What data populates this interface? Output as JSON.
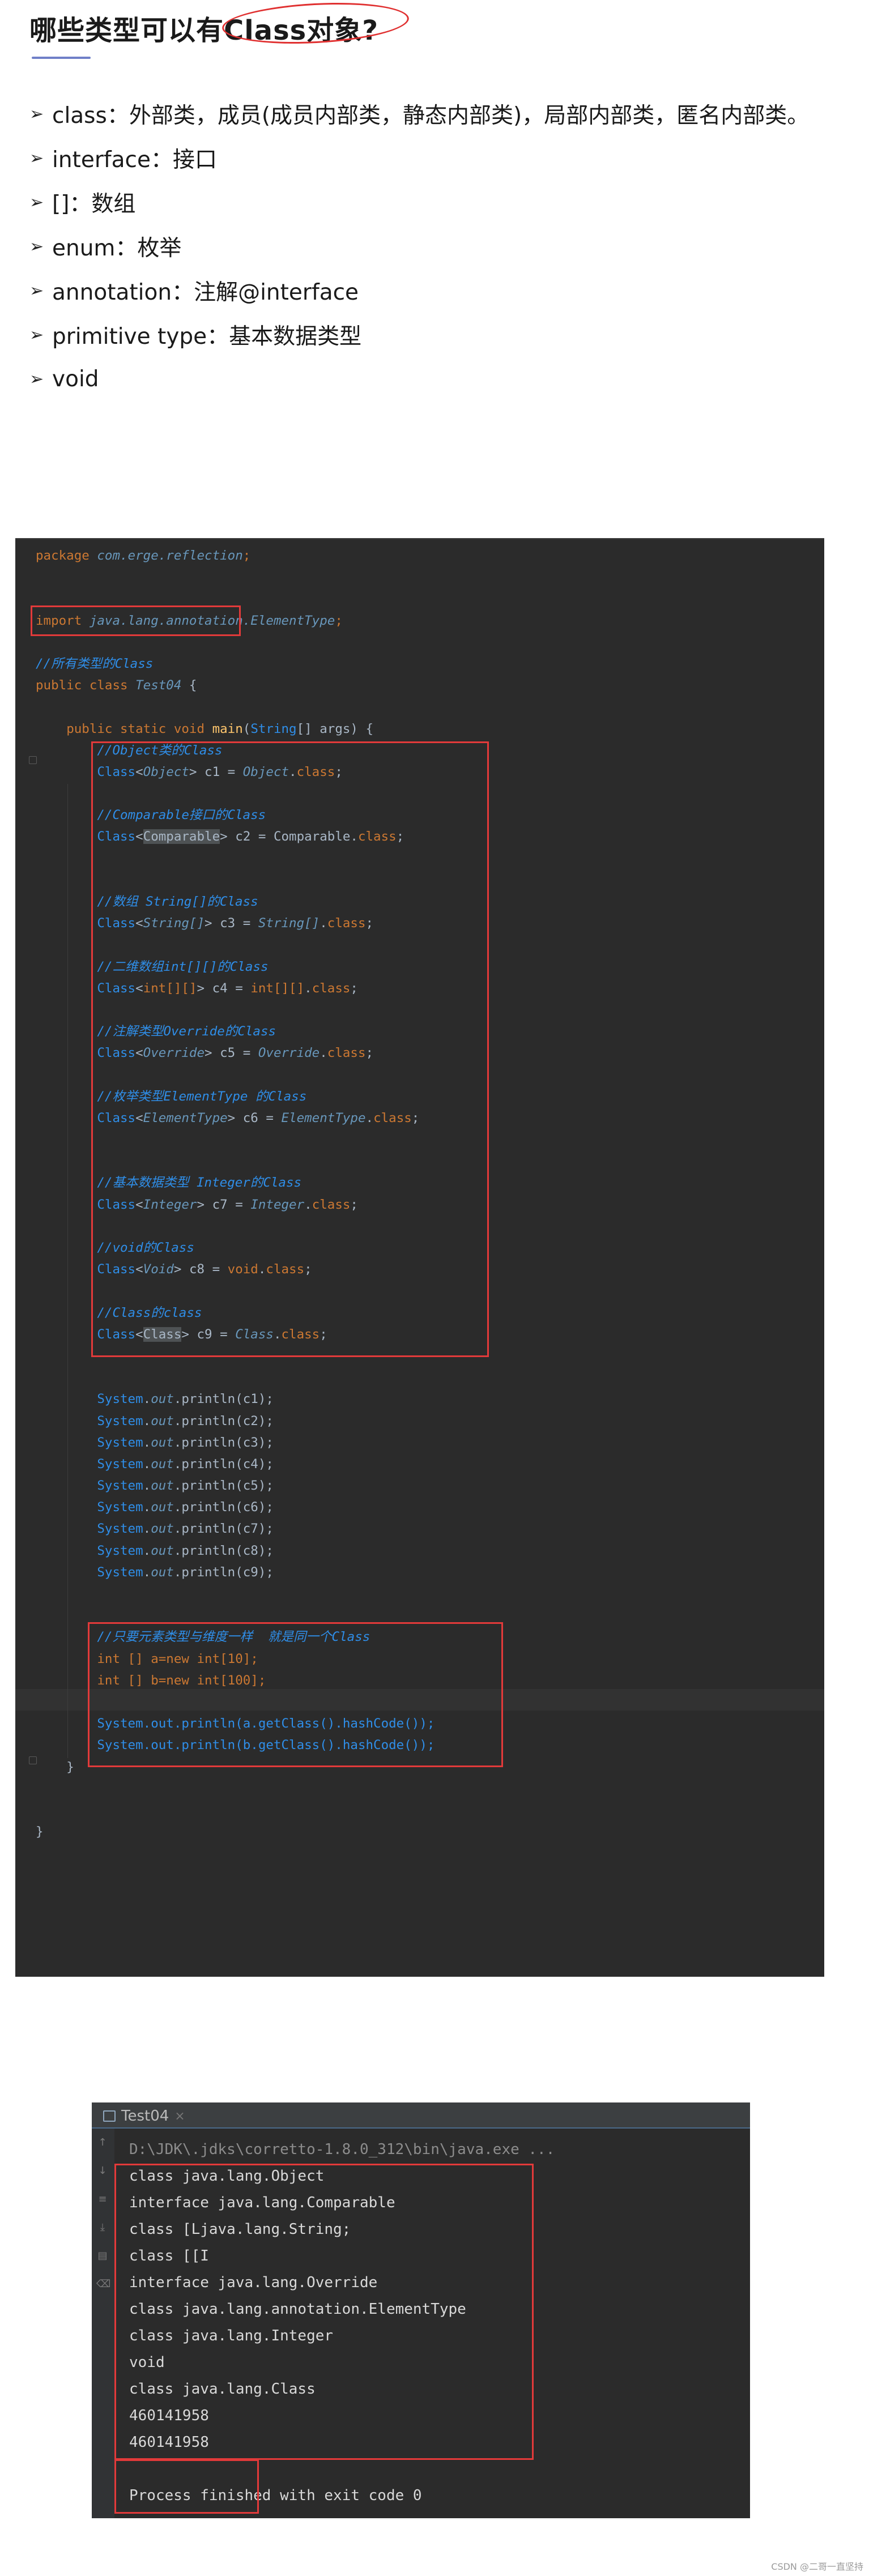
{
  "heading": {
    "title": "哪些类型可以有Class对象?"
  },
  "bullets": [
    "class：外部类，成员(成员内部类，静态内部类)，局部内部类，匿名内部类。",
    "interface：接口",
    "[]：数组",
    "enum：枚举",
    "annotation：注解@interface",
    "primitive type：基本数据类型",
    "void"
  ],
  "editor": {
    "package_kw": "package",
    "package_name": "com.erge.reflection",
    "import_kw": "import",
    "import_name": "java.lang.annotation.ElementType",
    "comment_all": "//所有类型的Class",
    "class_decl_kw": "public class",
    "class_name": "Test04",
    "main_sig_kw": "public static void",
    "main_name": "main",
    "main_param_type": "String",
    "main_param_rest": "[] args) {",
    "blocks": [
      {
        "comment": "//Object类的Class",
        "type": "Object",
        "var": "c1",
        "rhs_type": "Object"
      },
      {
        "comment": "//Comparable接口的Class",
        "type": "Comparable",
        "var": "c2",
        "rhs_type": "Comparable"
      },
      {
        "comment": "//数组 String[]的Class",
        "type": "String[]",
        "var": "c3",
        "rhs_type": "String[]"
      },
      {
        "comment": "//二维数组int[][]的Class",
        "type": "int[][]",
        "var": "c4",
        "rhs_type": "int[][]"
      },
      {
        "comment": "//注解类型Override的Class",
        "type": "Override",
        "var": "c5",
        "rhs_type": "Override"
      },
      {
        "comment": "//枚举类型ElementType 的Class",
        "type": "ElementType",
        "var": "c6",
        "rhs_type": "ElementType"
      },
      {
        "comment": "//基本数据类型 Integer的Class",
        "type": "Integer",
        "var": "c7",
        "rhs_type": "Integer"
      },
      {
        "comment": "//void的Class",
        "type": "Void",
        "var": "c8",
        "rhs_type": "void"
      },
      {
        "comment": "//Class的class",
        "type": "Class",
        "var": "c9",
        "rhs_type": "Class"
      }
    ],
    "println_vars": [
      "c1",
      "c2",
      "c3",
      "c4",
      "c5",
      "c6",
      "c7",
      "c8",
      "c9"
    ],
    "comment_same": "//只要元素类型与维度一样  就是同一个Class",
    "array_a": "int [] a=new int[10];",
    "array_b": "int [] b=new int[100];",
    "hash_a": "System.out.println(a.getClass().hashCode());",
    "hash_b": "System.out.println(b.getClass().hashCode());"
  },
  "console": {
    "tab_label": "Test04",
    "command": "D:\\JDK\\.jdks\\corretto-1.8.0_312\\bin\\java.exe ...",
    "lines": [
      "class java.lang.Object",
      "interface java.lang.Comparable",
      "class [Ljava.lang.String;",
      "class [[I",
      "interface java.lang.Override",
      "class java.lang.annotation.ElementType",
      "class java.lang.Integer",
      "void",
      "class java.lang.Class",
      "460141958",
      "460141958",
      "",
      "Process finished with exit code 0"
    ]
  },
  "watermark": "CSDN @二哥一直坚持",
  "colors": {
    "highlight_box": "#e23a3a",
    "editor_bg": "#2b2b2b",
    "keyword": "#cc7832",
    "comment": "#2f8ee8"
  }
}
